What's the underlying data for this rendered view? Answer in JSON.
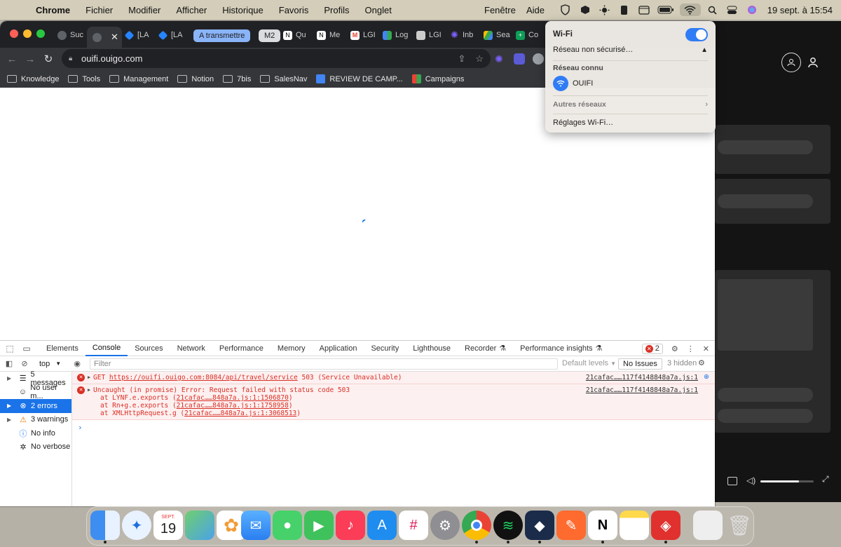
{
  "menubar": {
    "app": "Chrome",
    "items": [
      "Fichier",
      "Modifier",
      "Afficher",
      "Historique",
      "Favoris",
      "Profils",
      "Onglet"
    ],
    "right_items": [
      "Fenêtre",
      "Aide"
    ],
    "clock": "19 sept. à 15:54"
  },
  "tabs": [
    {
      "title": "Suc",
      "icon": "globe-icon"
    },
    {
      "title": "",
      "icon": "globe-icon",
      "active": true
    },
    {
      "title": "[LA",
      "icon": "jira-icon"
    },
    {
      "title": "[LA",
      "icon": "jira-icon"
    },
    {
      "title": "A transmettre",
      "group": true,
      "color": "#8ab4f8"
    },
    {
      "title": "M2",
      "group": true,
      "color": "#dadce0"
    },
    {
      "title": "Qu",
      "icon": "notion-icon"
    },
    {
      "title": "Me",
      "icon": "notion-icon"
    },
    {
      "title": "LGI",
      "icon": "gmail-icon"
    },
    {
      "title": "Log",
      "icon": "apps-icon"
    },
    {
      "title": "LGI",
      "icon": "doc-icon"
    },
    {
      "title": "Inb",
      "icon": "star-icon"
    },
    {
      "title": "Sea",
      "icon": "drive-icon"
    },
    {
      "title": "Co",
      "icon": "sheet-icon"
    }
  ],
  "omnibox": {
    "url": "ouifi.ouigo.com"
  },
  "bookmarks": [
    {
      "label": "Knowledge",
      "type": "folder"
    },
    {
      "label": "Tools",
      "type": "folder"
    },
    {
      "label": "Management",
      "type": "folder"
    },
    {
      "label": "Notion",
      "type": "folder"
    },
    {
      "label": "7bis",
      "type": "folder"
    },
    {
      "label": "SalesNav",
      "type": "folder"
    },
    {
      "label": "REVIEW DE CAMP...",
      "type": "link"
    },
    {
      "label": "Campaigns",
      "type": "link"
    }
  ],
  "devtools": {
    "tabs": [
      "Elements",
      "Console",
      "Sources",
      "Network",
      "Performance",
      "Memory",
      "Application",
      "Security",
      "Lighthouse",
      "Recorder",
      "Performance insights"
    ],
    "selected_tab": "Console",
    "error_count": "2",
    "context": "top",
    "filter_placeholder": "Filter",
    "levels": "Default levels",
    "issues": "No Issues",
    "hidden": "3 hidden",
    "sidebar": [
      {
        "label": "5 messages",
        "icon": "list-icon",
        "caret": true
      },
      {
        "label": "No user m...",
        "icon": "user-icon",
        "caret": false
      },
      {
        "label": "2 errors",
        "icon": "error-icon",
        "caret": true,
        "selected": true
      },
      {
        "label": "3 warnings",
        "icon": "warning-icon",
        "caret": true
      },
      {
        "label": "No info",
        "icon": "info-icon",
        "caret": false
      },
      {
        "label": "No verbose",
        "icon": "bug-icon",
        "caret": false
      }
    ],
    "logs": [
      {
        "method": "GET",
        "url": "https://ouifi.ouigo.com:8084/api/travel/service",
        "status": "503 (Service Unavailable)",
        "source": "21cafac……117f4148848a7a.js:1"
      },
      {
        "message": "Uncaught (in promise) Error: Request failed with status code 503",
        "source": "21cafac……117f4148848a7a.js:1",
        "stack": [
          {
            "prefix": "at LYNF.e.exports (",
            "link": "21cafac……848a7a.js:1:1506870",
            "suffix": ")"
          },
          {
            "prefix": "at Rn+g.e.exports (",
            "link": "21cafac……848a7a.js:1:1758958",
            "suffix": ")"
          },
          {
            "prefix": "at XMLHttpRequest.g (",
            "link": "21cafac……848a7a.js:1:3068513",
            "suffix": ")"
          }
        ]
      }
    ]
  },
  "wifi": {
    "title": "Wi-Fi",
    "unsecured": "Réseau non sécurisé…",
    "known_header": "Réseau connu",
    "network": "OUIFI",
    "other": "Autres réseaux",
    "settings": "Réglages Wi-Fi…"
  },
  "dock": {
    "calendar_month": "SEPT.",
    "calendar_day": "19",
    "icons": [
      "finder-icon",
      "safari-icon",
      "maps-icon",
      "photos-icon",
      "mail-icon",
      "messages-icon",
      "facetime-icon",
      "music-icon",
      "appstore-icon",
      "slack-icon",
      "settings-icon",
      "chrome-icon",
      "spotify-icon",
      "app-icon",
      "pen-icon",
      "notion-icon",
      "notes-icon",
      "security-icon",
      "preview-icon",
      "trash-icon"
    ]
  }
}
